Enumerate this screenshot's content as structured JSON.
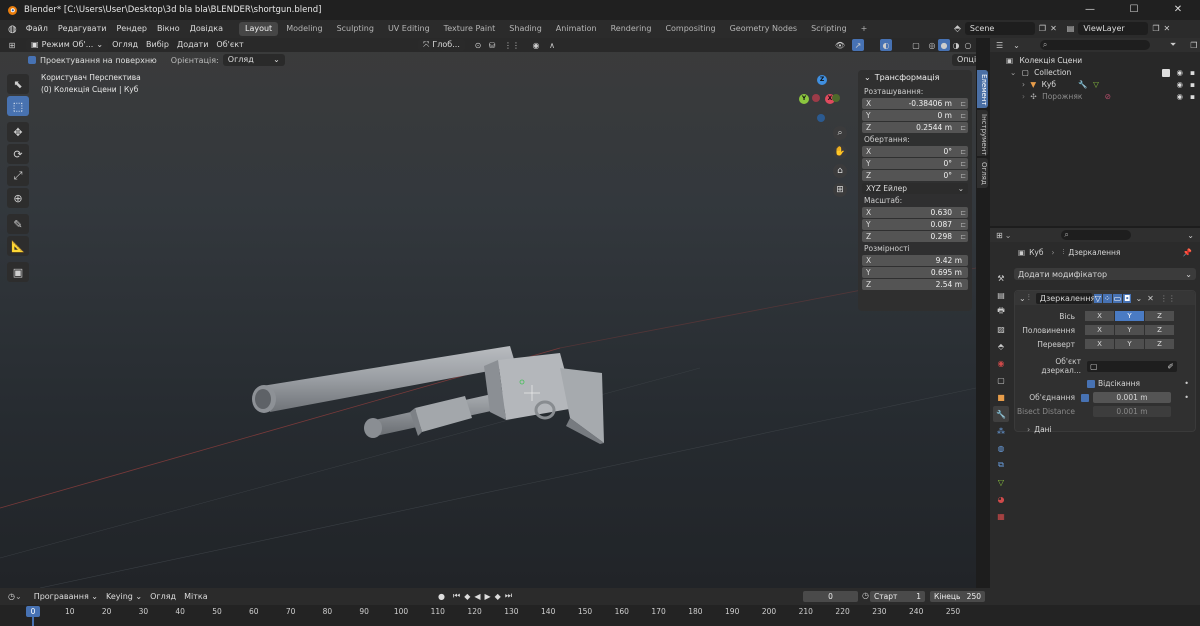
{
  "window": {
    "title": "Blender* [C:\\Users\\User\\Desktop\\3d bla bla\\BLENDER\\shortgun.blend]",
    "icon": "blender-logo-icon",
    "controls": [
      "—",
      "☐",
      "✕"
    ]
  },
  "menubar": {
    "menus": [
      "Файл",
      "Редагувати",
      "Рендер",
      "Вікно",
      "Довідка"
    ],
    "workspaces": [
      "Layout",
      "Modeling",
      "Sculpting",
      "UV Editing",
      "Texture Paint",
      "Shading",
      "Animation",
      "Rendering",
      "Compositing",
      "Geometry Nodes",
      "Scripting"
    ],
    "active_workspace": "Layout",
    "add_tab": "+",
    "scene": "Scene",
    "view_layer": "ViewLayer"
  },
  "viewport": {
    "mode": "Режим Об'...",
    "menus": [
      "Огляд",
      "Вибір",
      "Додати",
      "Об'єкт"
    ],
    "transform_orientation": "Глоб...",
    "project_on_surface": "Проектування на поверхню",
    "orientation_label": "Орієнтація:",
    "orientation_value": "Огляд",
    "options": "Опції",
    "overlay_line1": "Користувач Перспектива",
    "overlay_line2": "(0) Колекція Сцени | Куб",
    "gizmo": {
      "x": "X",
      "y": "Y",
      "z": "Z"
    }
  },
  "npanel": {
    "title": "Трансформація",
    "location_label": "Розташування:",
    "location": [
      {
        "ax": "X",
        "v": "-0.38406 m"
      },
      {
        "ax": "Y",
        "v": "0 m"
      },
      {
        "ax": "Z",
        "v": "0.2544 m"
      }
    ],
    "rotation_label": "Обертання:",
    "rotation": [
      {
        "ax": "X",
        "v": "0°"
      },
      {
        "ax": "Y",
        "v": "0°"
      },
      {
        "ax": "Z",
        "v": "0°"
      }
    ],
    "rotation_mode": "XYZ Ейлер",
    "scale_label": "Масштаб:",
    "scale": [
      {
        "ax": "X",
        "v": "0.630"
      },
      {
        "ax": "Y",
        "v": "0.087"
      },
      {
        "ax": "Z",
        "v": "0.298"
      }
    ],
    "dimensions_label": "Розмірності",
    "dimensions": [
      {
        "ax": "X",
        "v": "9.42 m"
      },
      {
        "ax": "Y",
        "v": "0.695 m"
      },
      {
        "ax": "Z",
        "v": "2.54 m"
      }
    ],
    "tabs": [
      "Елемент",
      "Інструмент",
      "Огляд"
    ]
  },
  "outliner": {
    "scene_collection": "Колекція Сцени",
    "collection": "Collection",
    "cube": "Куб",
    "empty": "Порожняк"
  },
  "properties": {
    "breadcrumb_object": "Куб",
    "breadcrumb_modifier": "Дзеркалення",
    "add_modifier": "Додати модифікатор",
    "modifier_name": "Дзеркалення",
    "axis_label": "Вісь",
    "bisect_label": "Половинення",
    "flip_label": "Переверт",
    "axes": [
      "X",
      "Y",
      "Z"
    ],
    "mirror_object_label": "Об'єкт дзеркал...",
    "clipping_label": "Відсікання",
    "merge_label": "Об'єднання",
    "merge_value": "0.001 m",
    "bisect_distance_label": "Bisect Distance",
    "bisect_distance_value": "0.001 m",
    "data_label": "Дані"
  },
  "timeline": {
    "playback": "Програвання",
    "keying": "Keying",
    "view": "Огляд",
    "marker": "Мітка",
    "current_frame": "0",
    "start_label": "Старт",
    "start": "1",
    "end_label": "Кінець",
    "end": "250",
    "ticks": [
      "0",
      "10",
      "20",
      "30",
      "40",
      "50",
      "60",
      "70",
      "80",
      "90",
      "100",
      "110",
      "120",
      "130",
      "140",
      "150",
      "160",
      "170",
      "180",
      "190",
      "200",
      "210",
      "220",
      "230",
      "240",
      "250"
    ]
  },
  "colors": {
    "accent": "#4772b3",
    "axis_x": "#e04a5e",
    "axis_y": "#8cc63f",
    "axis_z": "#3f8fe0"
  }
}
